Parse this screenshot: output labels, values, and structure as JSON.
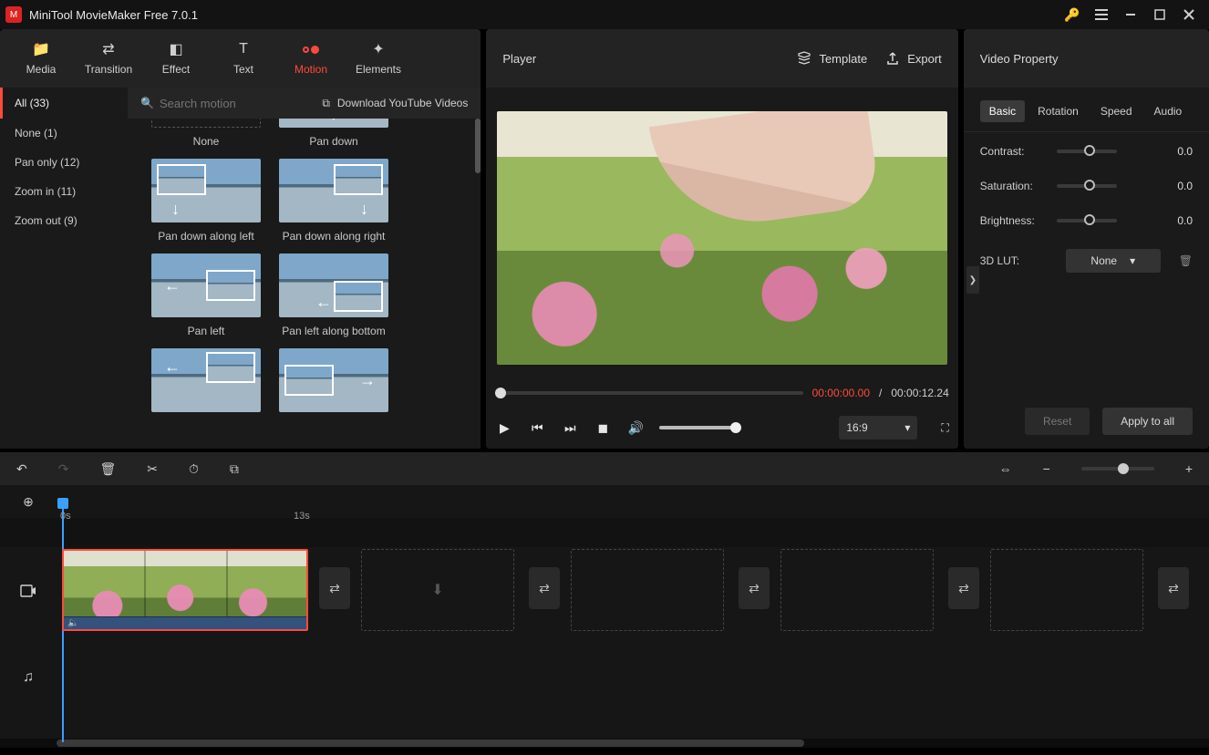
{
  "app": {
    "title": "MiniTool MovieMaker Free 7.0.1"
  },
  "toolbar_tabs": {
    "media": "Media",
    "transition": "Transition",
    "effect": "Effect",
    "text": "Text",
    "motion": "Motion",
    "elements": "Elements"
  },
  "library": {
    "search_placeholder": "Search motion",
    "download_label": "Download YouTube Videos",
    "categories": {
      "all": "All (33)",
      "none": "None (1)",
      "pan_only": "Pan only (12)",
      "zoom_in": "Zoom in (11)",
      "zoom_out": "Zoom out (9)"
    },
    "items": {
      "none": "None",
      "pan_down": "Pan down",
      "pan_down_left": "Pan down along left",
      "pan_down_right": "Pan down along right",
      "pan_left": "Pan left",
      "pan_left_bottom": "Pan left along bottom"
    }
  },
  "player": {
    "title": "Player",
    "template": "Template",
    "export": "Export",
    "time_current": "00:00:00.00",
    "time_sep": "/",
    "time_duration": "00:00:12.24",
    "aspect": "16:9"
  },
  "props": {
    "title": "Video Property",
    "tabs": {
      "basic": "Basic",
      "rotation": "Rotation",
      "speed": "Speed",
      "audio": "Audio"
    },
    "contrast_label": "Contrast:",
    "contrast_val": "0.0",
    "saturation_label": "Saturation:",
    "saturation_val": "0.0",
    "brightness_label": "Brightness:",
    "brightness_val": "0.0",
    "lut_label": "3D LUT:",
    "lut_value": "None",
    "reset": "Reset",
    "apply": "Apply to all"
  },
  "timeline": {
    "mark0": "0s",
    "mark1": "13s"
  }
}
